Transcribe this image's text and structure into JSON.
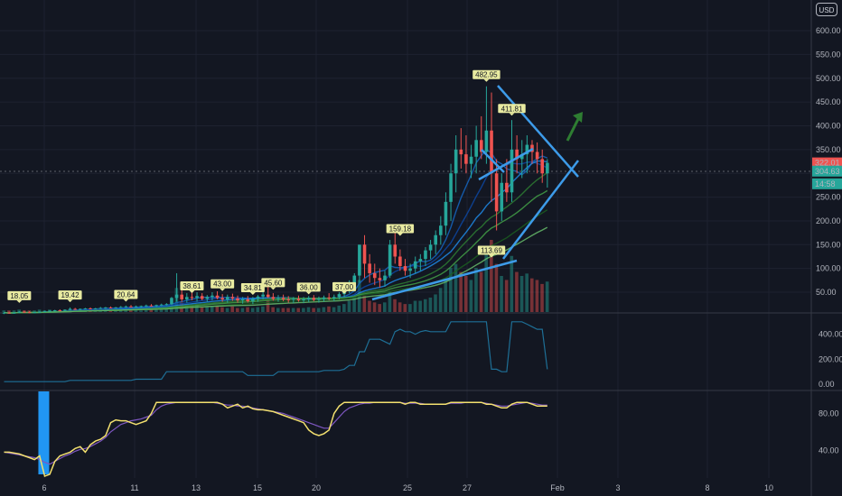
{
  "currency": "USD",
  "colors": {
    "background": "#131722",
    "grid": "#1e2230",
    "up": "#26a69a",
    "down": "#ef5350",
    "drawing": "#3d9be9",
    "arrow": "#2e7d32",
    "indicator_line": "#1e6f96",
    "stoch_k": "#f3e06f",
    "stoch_d": "#7e57c2",
    "highlight_bar": "#2196f3"
  },
  "chart_data": {
    "type": "candlestick",
    "x_ticks": [
      "6",
      "11",
      "13",
      "15",
      "20",
      "25",
      "27",
      "Feb",
      "3",
      "8",
      "10"
    ],
    "price_axis": {
      "ticks": [
        "600.00",
        "550.00",
        "500.00",
        "450.00",
        "400.00",
        "350.00",
        "300.00",
        "250.00",
        "200.00",
        "150.00",
        "100.00",
        "50.00"
      ],
      "range": [
        0,
        620
      ]
    },
    "price_labels": [
      {
        "text": "322.01",
        "color": "#ef5350",
        "value": 322.01
      },
      {
        "text": "304.63",
        "color": "#26a69a",
        "value": 304.63
      },
      {
        "text": "14:58",
        "color": "#26a69a",
        "value": 278
      }
    ],
    "marker_tags": [
      {
        "text": "18.05",
        "index": 3,
        "value": 18.05
      },
      {
        "text": "19.42",
        "index": 13,
        "value": 19.42
      },
      {
        "text": "20.64",
        "index": 24,
        "value": 20.64
      },
      {
        "text": "38.61",
        "index": 37,
        "value": 38.61
      },
      {
        "text": "43.00",
        "index": 43,
        "value": 43.0
      },
      {
        "text": "34.81",
        "index": 49,
        "value": 34.81
      },
      {
        "text": "45.60",
        "index": 53,
        "value": 45.6
      },
      {
        "text": "36.00",
        "index": 60,
        "value": 36.0
      },
      {
        "text": "37.00",
        "index": 67,
        "value": 37.0
      },
      {
        "text": "159.18",
        "index": 78,
        "value": 159.18
      },
      {
        "text": "482.95",
        "index": 95,
        "value": 482.95
      },
      {
        "text": "411.81",
        "index": 100,
        "value": 411.81
      },
      {
        "text": "113.69",
        "index": 96,
        "value": 113.69
      }
    ],
    "ohlc": [
      [
        6,
        8,
        4,
        7
      ],
      [
        7,
        9,
        5,
        6
      ],
      [
        6,
        8,
        5,
        7
      ],
      [
        7,
        10,
        6,
        9
      ],
      [
        9,
        11,
        7,
        8
      ],
      [
        8,
        10,
        6,
        7
      ],
      [
        7,
        9,
        6,
        8
      ],
      [
        8,
        10,
        7,
        9
      ],
      [
        9,
        11,
        8,
        10
      ],
      [
        10,
        12,
        9,
        11
      ],
      [
        11,
        13,
        9,
        12
      ],
      [
        12,
        14,
        10,
        11
      ],
      [
        11,
        14,
        10,
        13
      ],
      [
        13,
        18,
        12,
        15
      ],
      [
        15,
        17,
        13,
        14
      ],
      [
        14,
        16,
        12,
        15
      ],
      [
        15,
        17,
        14,
        16
      ],
      [
        16,
        18,
        14,
        15
      ],
      [
        15,
        17,
        14,
        16
      ],
      [
        16,
        19,
        15,
        17
      ],
      [
        17,
        19,
        15,
        18
      ],
      [
        18,
        20,
        16,
        17
      ],
      [
        17,
        19,
        16,
        18
      ],
      [
        18,
        21,
        17,
        19
      ],
      [
        19,
        22,
        17,
        20
      ],
      [
        20,
        23,
        18,
        19
      ],
      [
        19,
        22,
        18,
        20
      ],
      [
        20,
        22,
        18,
        21
      ],
      [
        21,
        24,
        19,
        22
      ],
      [
        22,
        25,
        20,
        21
      ],
      [
        21,
        24,
        19,
        23
      ],
      [
        23,
        26,
        21,
        24
      ],
      [
        24,
        27,
        22,
        25
      ],
      [
        25,
        40,
        23,
        38
      ],
      [
        38,
        90,
        30,
        45
      ],
      [
        45,
        55,
        30,
        35
      ],
      [
        35,
        48,
        28,
        40
      ],
      [
        40,
        52,
        33,
        38
      ],
      [
        38,
        50,
        30,
        42
      ],
      [
        42,
        48,
        33,
        36
      ],
      [
        36,
        44,
        30,
        40
      ],
      [
        40,
        50,
        33,
        43
      ],
      [
        43,
        52,
        35,
        38
      ],
      [
        38,
        46,
        30,
        35
      ],
      [
        35,
        45,
        28,
        40
      ],
      [
        40,
        47,
        32,
        37
      ],
      [
        37,
        43,
        28,
        33
      ],
      [
        33,
        40,
        26,
        35
      ],
      [
        35,
        42,
        28,
        31
      ],
      [
        31,
        40,
        25,
        36
      ],
      [
        36,
        44,
        30,
        41
      ],
      [
        41,
        50,
        35,
        45
      ],
      [
        45,
        68,
        38,
        40
      ],
      [
        40,
        48,
        32,
        36
      ],
      [
        36,
        44,
        30,
        38
      ],
      [
        38,
        45,
        31,
        35
      ],
      [
        35,
        42,
        28,
        34
      ],
      [
        34,
        40,
        27,
        36
      ],
      [
        36,
        43,
        30,
        33
      ],
      [
        33,
        40,
        27,
        35
      ],
      [
        35,
        42,
        29,
        38
      ],
      [
        38,
        44,
        31,
        34
      ],
      [
        34,
        41,
        28,
        36
      ],
      [
        36,
        43,
        30,
        39
      ],
      [
        39,
        48,
        33,
        37
      ],
      [
        37,
        45,
        31,
        40
      ],
      [
        40,
        50,
        35,
        46
      ],
      [
        46,
        60,
        40,
        55
      ],
      [
        55,
        75,
        48,
        68
      ],
      [
        68,
        90,
        60,
        85
      ],
      [
        85,
        120,
        70,
        150
      ],
      [
        150,
        170,
        80,
        110
      ],
      [
        110,
        130,
        70,
        90
      ],
      [
        90,
        110,
        65,
        80
      ],
      [
        80,
        100,
        60,
        75
      ],
      [
        75,
        95,
        62,
        85
      ],
      [
        85,
        160,
        80,
        150
      ],
      [
        150,
        175,
        110,
        125
      ],
      [
        125,
        140,
        95,
        105
      ],
      [
        105,
        120,
        85,
        95
      ],
      [
        95,
        110,
        80,
        100
      ],
      [
        100,
        125,
        90,
        115
      ],
      [
        115,
        130,
        95,
        120
      ],
      [
        120,
        145,
        105,
        138
      ],
      [
        138,
        160,
        120,
        150
      ],
      [
        150,
        180,
        130,
        170
      ],
      [
        170,
        210,
        150,
        190
      ],
      [
        190,
        260,
        170,
        240
      ],
      [
        240,
        320,
        200,
        300
      ],
      [
        300,
        380,
        260,
        350
      ],
      [
        350,
        395,
        310,
        340
      ],
      [
        340,
        380,
        300,
        320
      ],
      [
        320,
        360,
        290,
        335
      ],
      [
        335,
        400,
        300,
        370
      ],
      [
        370,
        420,
        330,
        345
      ],
      [
        345,
        483,
        320,
        390
      ],
      [
        390,
        470,
        240,
        300
      ],
      [
        300,
        330,
        180,
        220
      ],
      [
        220,
        300,
        200,
        280
      ],
      [
        280,
        330,
        240,
        260
      ],
      [
        260,
        412,
        240,
        350
      ],
      [
        350,
        380,
        300,
        330
      ],
      [
        330,
        370,
        290,
        340
      ],
      [
        340,
        380,
        300,
        360
      ],
      [
        360,
        370,
        320,
        345
      ],
      [
        345,
        365,
        300,
        330
      ],
      [
        330,
        350,
        280,
        300
      ],
      [
        300,
        330,
        270,
        322
      ]
    ],
    "volume": [
      2,
      2,
      2,
      3,
      2,
      2,
      2,
      3,
      2,
      3,
      2,
      2,
      3,
      4,
      3,
      2,
      3,
      2,
      2,
      3,
      3,
      2,
      2,
      3,
      3,
      2,
      3,
      2,
      3,
      3,
      3,
      3,
      4,
      8,
      30,
      12,
      8,
      7,
      9,
      6,
      6,
      7,
      8,
      6,
      5,
      7,
      5,
      5,
      6,
      5,
      6,
      7,
      15,
      6,
      5,
      5,
      5,
      5,
      5,
      5,
      6,
      5,
      5,
      6,
      7,
      6,
      8,
      10,
      14,
      18,
      40,
      20,
      14,
      12,
      10,
      12,
      25,
      16,
      12,
      10,
      10,
      14,
      14,
      16,
      18,
      22,
      30,
      40,
      55,
      60,
      50,
      45,
      40,
      55,
      50,
      80,
      90,
      60,
      45,
      40,
      70,
      50,
      45,
      48,
      42,
      40,
      35,
      38
    ],
    "sub_indicator": {
      "ticks": [
        "400.00",
        "200.00",
        "0.00"
      ],
      "range": [
        0,
        520
      ],
      "values": [
        20,
        20,
        20,
        20,
        20,
        20,
        20,
        20,
        20,
        20,
        20,
        20,
        20,
        30,
        30,
        30,
        30,
        30,
        30,
        30,
        30,
        30,
        30,
        30,
        30,
        30,
        40,
        40,
        40,
        40,
        40,
        40,
        100,
        100,
        100,
        100,
        100,
        100,
        100,
        100,
        100,
        100,
        100,
        100,
        100,
        100,
        100,
        100,
        70,
        70,
        70,
        70,
        70,
        70,
        100,
        100,
        100,
        100,
        100,
        100,
        100,
        100,
        100,
        110,
        110,
        110,
        110,
        120,
        150,
        150,
        260,
        260,
        360,
        360,
        360,
        340,
        320,
        420,
        440,
        420,
        420,
        400,
        420,
        430,
        420,
        420,
        420,
        420,
        500,
        500,
        500,
        500,
        500,
        500,
        500,
        500,
        120,
        120,
        100,
        100,
        500,
        500,
        500,
        480,
        460,
        440,
        440,
        120
      ]
    },
    "stoch": {
      "ticks": [
        "80.00",
        "40.00"
      ],
      "range": [
        10,
        100
      ],
      "highlight_index": 8,
      "k": [
        38,
        38,
        37,
        36,
        34,
        32,
        30,
        34,
        12,
        14,
        28,
        34,
        36,
        38,
        42,
        44,
        38,
        46,
        50,
        52,
        56,
        70,
        73,
        72,
        72,
        70,
        68,
        70,
        72,
        80,
        92,
        92,
        92,
        92,
        92,
        92,
        92,
        92,
        92,
        92,
        92,
        92,
        92,
        90,
        86,
        88,
        90,
        86,
        88,
        85,
        84,
        84,
        83,
        82,
        80,
        78,
        76,
        74,
        72,
        70,
        62,
        58,
        56,
        58,
        62,
        80,
        88,
        92,
        92,
        92,
        92,
        92,
        92,
        92,
        92,
        92,
        92,
        92,
        92,
        90,
        92,
        92,
        90,
        90,
        90,
        90,
        90,
        90,
        92,
        92,
        92,
        92,
        92,
        92,
        92,
        90,
        90,
        88,
        86,
        86,
        90,
        92,
        92,
        92,
        90,
        88,
        88,
        88
      ],
      "d": [
        38,
        37,
        36,
        35,
        34,
        33,
        32,
        30,
        27,
        25,
        28,
        31,
        34,
        36,
        39,
        41,
        42,
        44,
        47,
        50,
        54,
        60,
        64,
        68,
        70,
        72,
        73,
        74,
        76,
        78,
        84,
        88,
        90,
        91,
        92,
        92,
        92,
        92,
        92,
        92,
        92,
        92,
        91,
        90,
        89,
        89,
        88,
        88,
        87,
        86,
        85,
        84,
        83,
        82,
        81,
        80,
        78,
        76,
        74,
        72,
        70,
        68,
        66,
        64,
        64,
        70,
        76,
        82,
        86,
        88,
        90,
        91,
        91,
        92,
        92,
        92,
        92,
        92,
        92,
        91,
        91,
        91,
        91,
        90,
        90,
        90,
        90,
        90,
        91,
        91,
        91,
        92,
        92,
        92,
        92,
        91,
        90,
        89,
        88,
        88,
        89,
        90,
        91,
        92,
        91,
        90,
        89,
        89
      ]
    }
  }
}
